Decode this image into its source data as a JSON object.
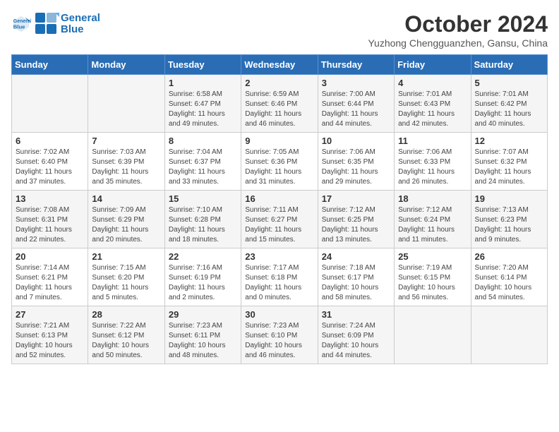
{
  "header": {
    "logo_line1": "General",
    "logo_line2": "Blue",
    "month": "October 2024",
    "location": "Yuzhong Chengguanzhen, Gansu, China"
  },
  "weekdays": [
    "Sunday",
    "Monday",
    "Tuesday",
    "Wednesday",
    "Thursday",
    "Friday",
    "Saturday"
  ],
  "weeks": [
    [
      {
        "day": "",
        "info": ""
      },
      {
        "day": "",
        "info": ""
      },
      {
        "day": "1",
        "info": "Sunrise: 6:58 AM\nSunset: 6:47 PM\nDaylight: 11 hours and 49 minutes."
      },
      {
        "day": "2",
        "info": "Sunrise: 6:59 AM\nSunset: 6:46 PM\nDaylight: 11 hours and 46 minutes."
      },
      {
        "day": "3",
        "info": "Sunrise: 7:00 AM\nSunset: 6:44 PM\nDaylight: 11 hours and 44 minutes."
      },
      {
        "day": "4",
        "info": "Sunrise: 7:01 AM\nSunset: 6:43 PM\nDaylight: 11 hours and 42 minutes."
      },
      {
        "day": "5",
        "info": "Sunrise: 7:01 AM\nSunset: 6:42 PM\nDaylight: 11 hours and 40 minutes."
      }
    ],
    [
      {
        "day": "6",
        "info": "Sunrise: 7:02 AM\nSunset: 6:40 PM\nDaylight: 11 hours and 37 minutes."
      },
      {
        "day": "7",
        "info": "Sunrise: 7:03 AM\nSunset: 6:39 PM\nDaylight: 11 hours and 35 minutes."
      },
      {
        "day": "8",
        "info": "Sunrise: 7:04 AM\nSunset: 6:37 PM\nDaylight: 11 hours and 33 minutes."
      },
      {
        "day": "9",
        "info": "Sunrise: 7:05 AM\nSunset: 6:36 PM\nDaylight: 11 hours and 31 minutes."
      },
      {
        "day": "10",
        "info": "Sunrise: 7:06 AM\nSunset: 6:35 PM\nDaylight: 11 hours and 29 minutes."
      },
      {
        "day": "11",
        "info": "Sunrise: 7:06 AM\nSunset: 6:33 PM\nDaylight: 11 hours and 26 minutes."
      },
      {
        "day": "12",
        "info": "Sunrise: 7:07 AM\nSunset: 6:32 PM\nDaylight: 11 hours and 24 minutes."
      }
    ],
    [
      {
        "day": "13",
        "info": "Sunrise: 7:08 AM\nSunset: 6:31 PM\nDaylight: 11 hours and 22 minutes."
      },
      {
        "day": "14",
        "info": "Sunrise: 7:09 AM\nSunset: 6:29 PM\nDaylight: 11 hours and 20 minutes."
      },
      {
        "day": "15",
        "info": "Sunrise: 7:10 AM\nSunset: 6:28 PM\nDaylight: 11 hours and 18 minutes."
      },
      {
        "day": "16",
        "info": "Sunrise: 7:11 AM\nSunset: 6:27 PM\nDaylight: 11 hours and 15 minutes."
      },
      {
        "day": "17",
        "info": "Sunrise: 7:12 AM\nSunset: 6:25 PM\nDaylight: 11 hours and 13 minutes."
      },
      {
        "day": "18",
        "info": "Sunrise: 7:12 AM\nSunset: 6:24 PM\nDaylight: 11 hours and 11 minutes."
      },
      {
        "day": "19",
        "info": "Sunrise: 7:13 AM\nSunset: 6:23 PM\nDaylight: 11 hours and 9 minutes."
      }
    ],
    [
      {
        "day": "20",
        "info": "Sunrise: 7:14 AM\nSunset: 6:21 PM\nDaylight: 11 hours and 7 minutes."
      },
      {
        "day": "21",
        "info": "Sunrise: 7:15 AM\nSunset: 6:20 PM\nDaylight: 11 hours and 5 minutes."
      },
      {
        "day": "22",
        "info": "Sunrise: 7:16 AM\nSunset: 6:19 PM\nDaylight: 11 hours and 2 minutes."
      },
      {
        "day": "23",
        "info": "Sunrise: 7:17 AM\nSunset: 6:18 PM\nDaylight: 11 hours and 0 minutes."
      },
      {
        "day": "24",
        "info": "Sunrise: 7:18 AM\nSunset: 6:17 PM\nDaylight: 10 hours and 58 minutes."
      },
      {
        "day": "25",
        "info": "Sunrise: 7:19 AM\nSunset: 6:15 PM\nDaylight: 10 hours and 56 minutes."
      },
      {
        "day": "26",
        "info": "Sunrise: 7:20 AM\nSunset: 6:14 PM\nDaylight: 10 hours and 54 minutes."
      }
    ],
    [
      {
        "day": "27",
        "info": "Sunrise: 7:21 AM\nSunset: 6:13 PM\nDaylight: 10 hours and 52 minutes."
      },
      {
        "day": "28",
        "info": "Sunrise: 7:22 AM\nSunset: 6:12 PM\nDaylight: 10 hours and 50 minutes."
      },
      {
        "day": "29",
        "info": "Sunrise: 7:23 AM\nSunset: 6:11 PM\nDaylight: 10 hours and 48 minutes."
      },
      {
        "day": "30",
        "info": "Sunrise: 7:23 AM\nSunset: 6:10 PM\nDaylight: 10 hours and 46 minutes."
      },
      {
        "day": "31",
        "info": "Sunrise: 7:24 AM\nSunset: 6:09 PM\nDaylight: 10 hours and 44 minutes."
      },
      {
        "day": "",
        "info": ""
      },
      {
        "day": "",
        "info": ""
      }
    ]
  ]
}
